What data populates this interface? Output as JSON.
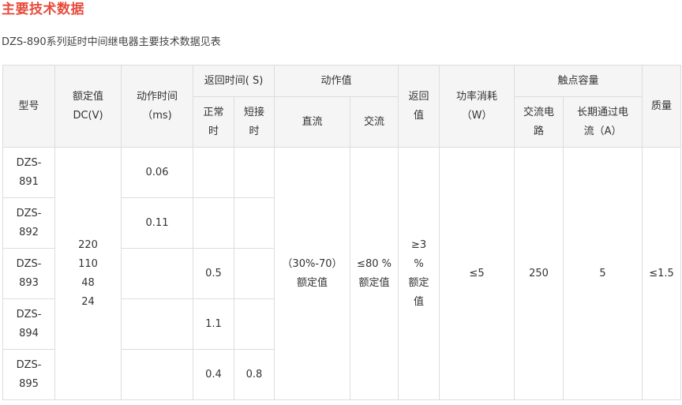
{
  "heading": "主要技术数据",
  "intro": "DZS-890系列延时中间继电器主要技术数据见表",
  "table": {
    "headers": {
      "model": "型号",
      "rated_value": [
        "额定值",
        "DC(V)"
      ],
      "action_time": [
        "动作时间",
        "（ms)"
      ],
      "return_time": "返回时间( S)",
      "return_normal": [
        "正常",
        "时"
      ],
      "return_short": [
        "短接",
        "时"
      ],
      "action_value": "动作值",
      "dc": "直流",
      "ac": "交流",
      "return_value": [
        "返回",
        "值"
      ],
      "power": [
        "功率消耗",
        "（W）"
      ],
      "contact_capacity": "触点容量",
      "ac_circuit": [
        "交流电",
        "路"
      ],
      "long_current": [
        "长期通过电",
        "流（A）"
      ],
      "weight": "质量"
    },
    "rows": [
      {
        "model": [
          "DZS-",
          "891"
        ],
        "action_time": "0.06",
        "return_normal": "",
        "return_short": ""
      },
      {
        "model": [
          "DZS-",
          "892"
        ],
        "action_time": "0.11",
        "return_normal": "",
        "return_short": ""
      },
      {
        "model": [
          "DZS-",
          "893"
        ],
        "action_time": "",
        "return_normal": "0.5",
        "return_short": ""
      },
      {
        "model": [
          "DZS-",
          "894"
        ],
        "action_time": "",
        "return_normal": "1.1",
        "return_short": ""
      },
      {
        "model": [
          "DZS-",
          "895"
        ],
        "action_time": "",
        "return_normal": "0.4",
        "return_short": "0.8"
      }
    ],
    "shared": {
      "rated_values": [
        "220",
        "110",
        "48",
        "24"
      ],
      "dc_action": [
        "（30%-70）",
        "额定值"
      ],
      "ac_action": [
        "≤80 %",
        "额定值"
      ],
      "return_value": [
        "≥3",
        "%",
        "额定",
        "值"
      ],
      "power": "≤5",
      "ac_circuit": "250",
      "long_current": "5",
      "weight": "≤1.5"
    }
  }
}
